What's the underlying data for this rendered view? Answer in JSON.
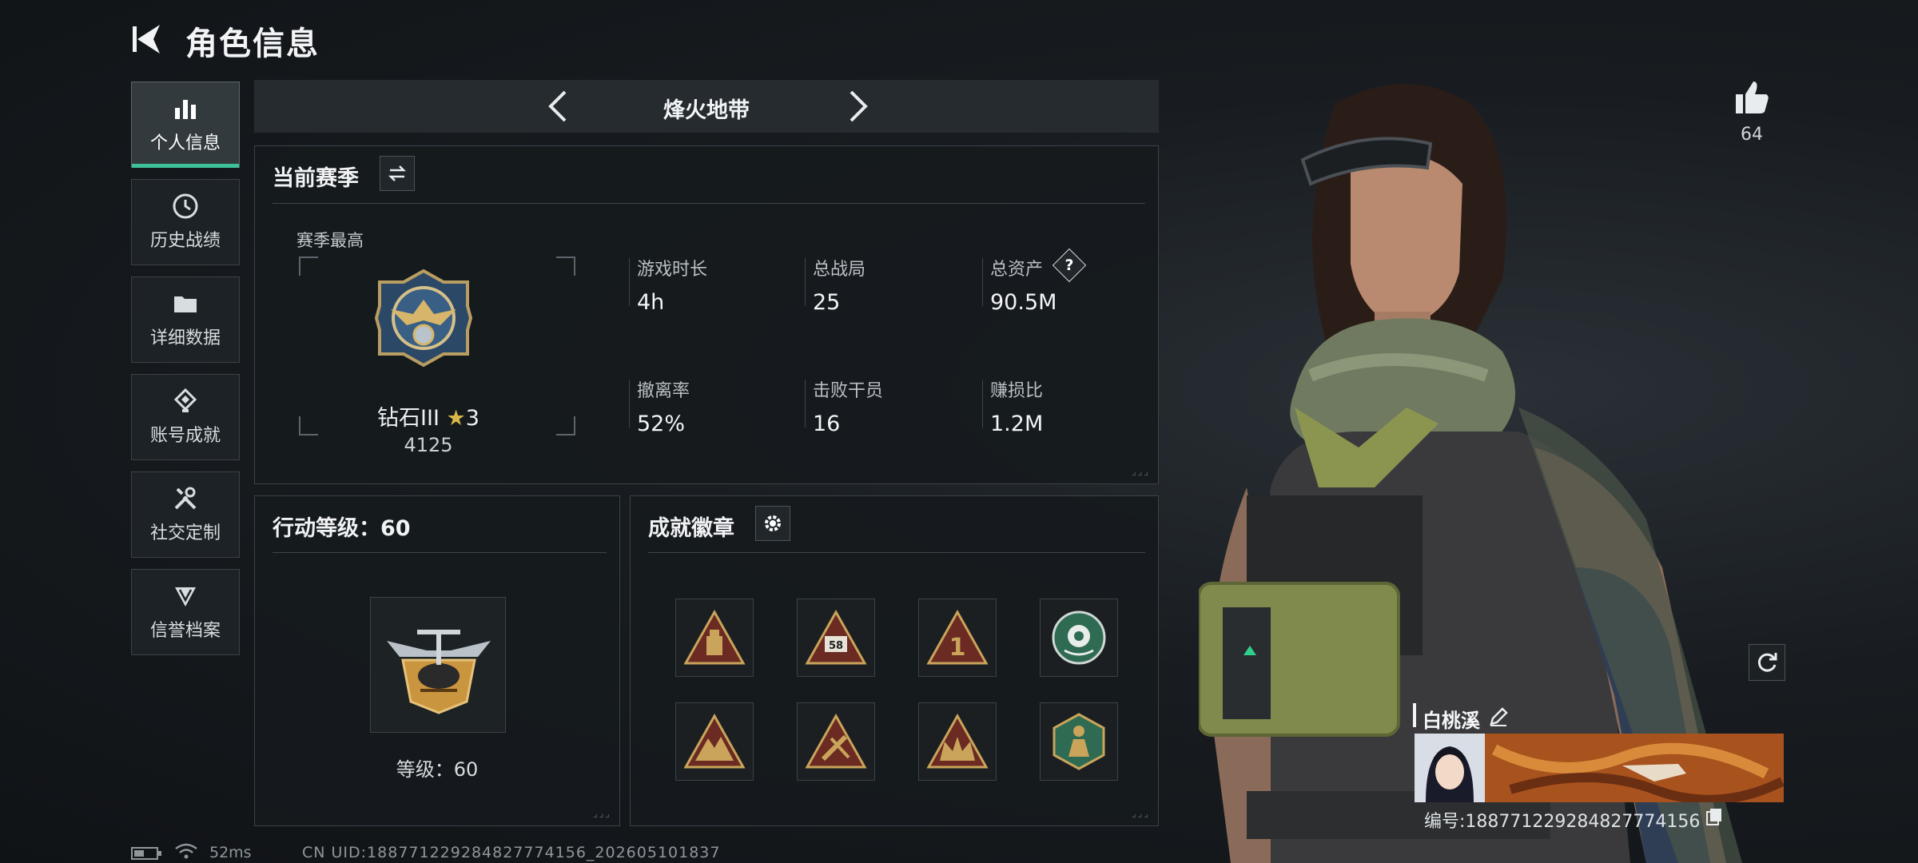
{
  "header": {
    "title": "角色信息"
  },
  "sidebar": {
    "items": [
      {
        "label": "个人信息",
        "active": true,
        "icon": "bar-chart-icon"
      },
      {
        "label": "历史战绩",
        "active": false,
        "icon": "clock-icon"
      },
      {
        "label": "详细数据",
        "active": false,
        "icon": "folder-icon"
      },
      {
        "label": "账号成就",
        "active": false,
        "icon": "achievement-icon"
      },
      {
        "label": "社交定制",
        "active": false,
        "icon": "tools-icon"
      },
      {
        "label": "信誉档案",
        "active": false,
        "icon": "shield-icon"
      }
    ]
  },
  "mode": {
    "name": "烽火地带"
  },
  "season": {
    "title": "当前赛季",
    "best_label": "赛季最高",
    "rank_name": "钻石III",
    "rank_stars": "3",
    "rank_score": "4125",
    "stats": [
      {
        "label": "游戏时长",
        "value": "4h"
      },
      {
        "label": "总战局",
        "value": "25"
      },
      {
        "label": "总资产",
        "value": "90.5M",
        "help": "?"
      },
      {
        "label": "撤离率",
        "value": "52%"
      },
      {
        "label": "击败干员",
        "value": "16"
      },
      {
        "label": "赚损比",
        "value": "1.2M"
      }
    ]
  },
  "action_level": {
    "title": "行动等级：60",
    "level_text": "等级：60"
  },
  "achievements": {
    "title": "成就徽章",
    "badge_icons": [
      "pyramid-badge-icon",
      "pyramid-58-badge-icon",
      "pyramid-1-badge-icon",
      "flower-round-badge-icon",
      "pyramid-ruins-badge-icon",
      "pyramid-tools-badge-icon",
      "pyramid-crown-badge-icon",
      "hexagon-figure-badge-icon"
    ],
    "badge_numbers": {
      "second": "58",
      "third": "1"
    }
  },
  "profile": {
    "likes": "64",
    "player_name": "白桃溪",
    "player_id": "编号:1887712292848277741​56"
  },
  "footer": {
    "ping": "52ms",
    "uid": "CN UID:1887712292848277741​56_202605101837"
  },
  "colors": {
    "accent": "#3ec29a",
    "gold": "#c9a45a",
    "badge_bg": "#6b2a22",
    "green_badge": "#2f6b52"
  }
}
